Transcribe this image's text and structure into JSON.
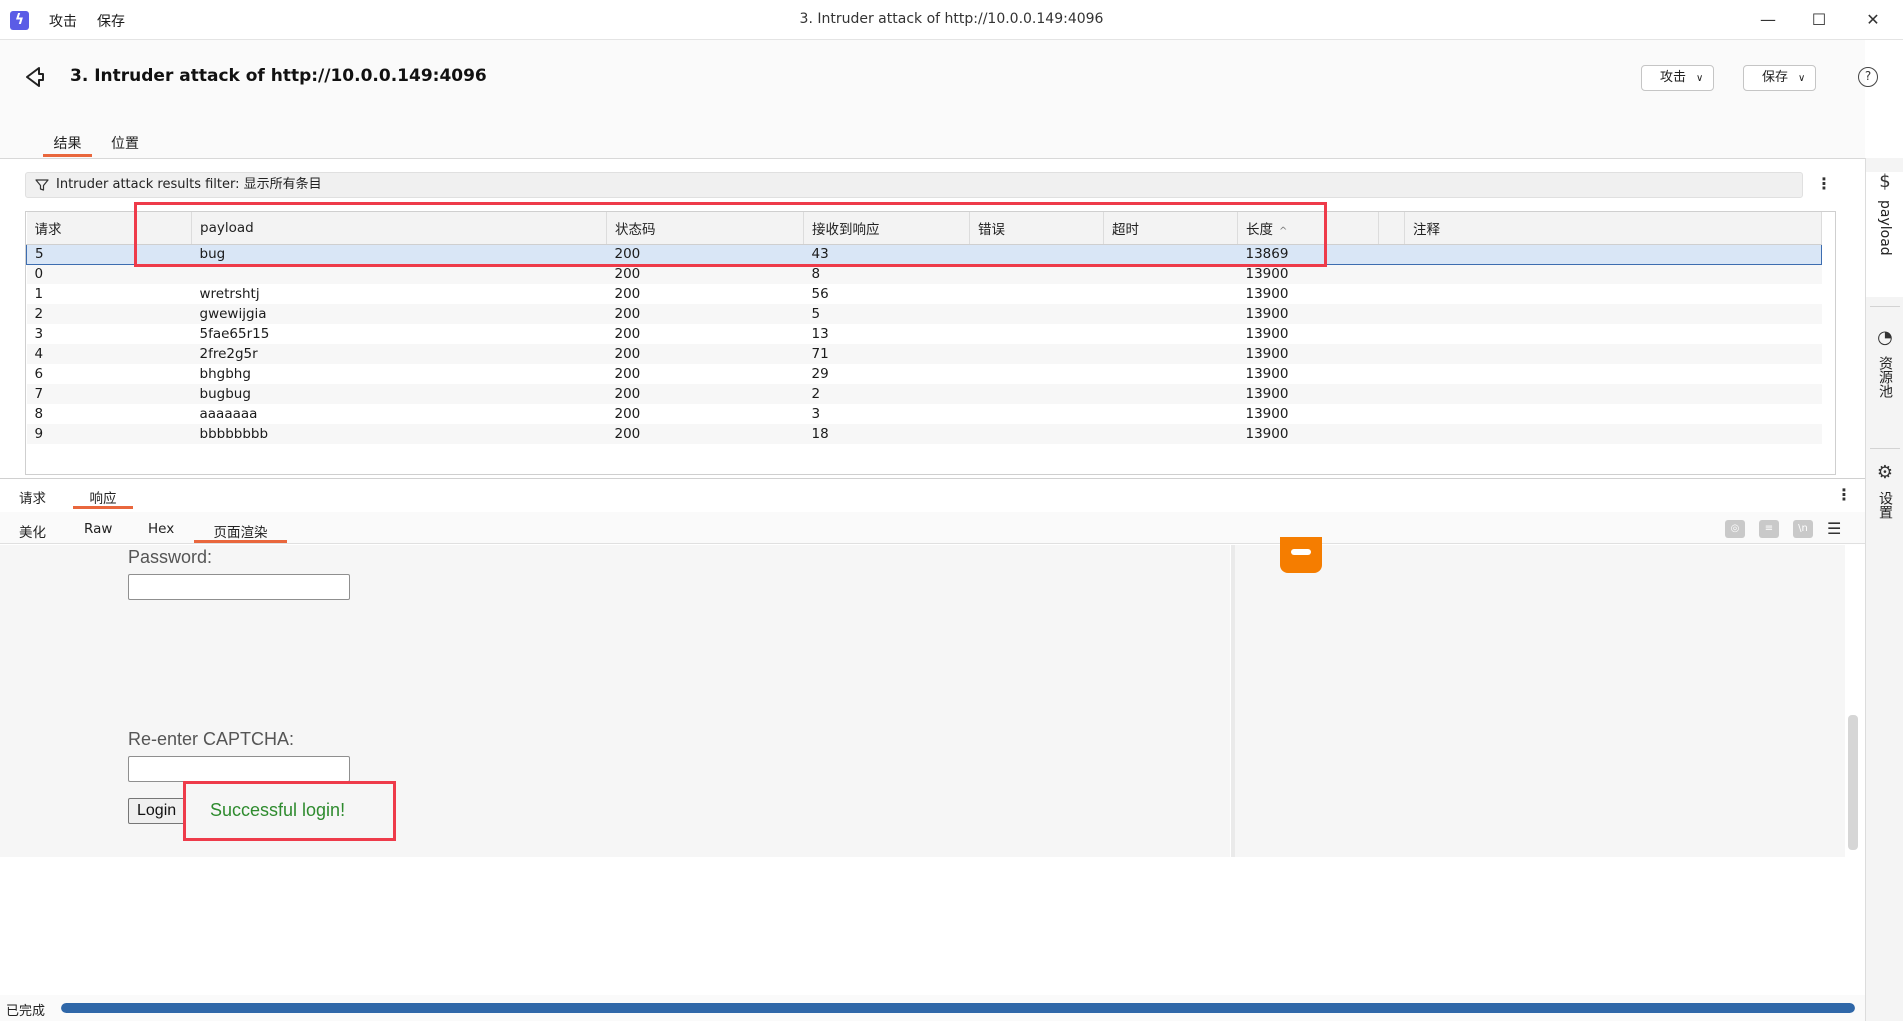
{
  "titlebar": {
    "menu": [
      "攻击",
      "保存"
    ],
    "window_title": "3. Intruder attack of http://10.0.0.149:4096",
    "controls": {
      "minimize": "—",
      "maximize": "☐",
      "close": "✕"
    }
  },
  "header": {
    "title": "3. Intruder attack of http://10.0.0.149:4096",
    "attack_button": "攻击",
    "save_button": "保存",
    "help": "?"
  },
  "tabs": [
    "结果",
    "位置"
  ],
  "filter": {
    "label": "Intruder attack results filter: 显示所有条目"
  },
  "table": {
    "columns": [
      "请求",
      "",
      "payload",
      "状态码",
      "接收到响应",
      "错误",
      "超时",
      "长度",
      "",
      "注释"
    ],
    "sort_icon": "^",
    "rows": [
      [
        "5",
        "",
        "bug",
        "200",
        "43",
        "",
        "",
        "13869",
        "",
        ""
      ],
      [
        "0",
        "",
        "",
        "200",
        "8",
        "",
        "",
        "13900",
        "",
        ""
      ],
      [
        "1",
        "",
        "wretrshtj",
        "200",
        "56",
        "",
        "",
        "13900",
        "",
        ""
      ],
      [
        "2",
        "",
        "gwewijgia",
        "200",
        "5",
        "",
        "",
        "13900",
        "",
        ""
      ],
      [
        "3",
        "",
        "5fae65r15",
        "200",
        "13",
        "",
        "",
        "13900",
        "",
        ""
      ],
      [
        "4",
        "",
        "2fre2g5r",
        "200",
        "71",
        "",
        "",
        "13900",
        "",
        ""
      ],
      [
        "6",
        "",
        "bhgbhg",
        "200",
        "29",
        "",
        "",
        "13900",
        "",
        ""
      ],
      [
        "7",
        "",
        "bugbug",
        "200",
        "2",
        "",
        "",
        "13900",
        "",
        ""
      ],
      [
        "8",
        "",
        "aaaaaaa",
        "200",
        "3",
        "",
        "",
        "13900",
        "",
        ""
      ],
      [
        "9",
        "",
        "bbbbbbbb",
        "200",
        "18",
        "",
        "",
        "13900",
        "",
        ""
      ]
    ],
    "selected_row": 0
  },
  "bottom_tabs": [
    "请求",
    "响应"
  ],
  "view_tabs": [
    "美化",
    "Raw",
    "Hex",
    "页面渲染"
  ],
  "render": {
    "password_label": "Password:",
    "captcha_label": "Re-enter CAPTCHA:",
    "login_button": "Login",
    "success_message": "Successful login!"
  },
  "status": {
    "text": "已完成",
    "progress": 1.0
  },
  "rail": {
    "payload": "payload",
    "resource_pool": "资源池",
    "settings": "设置"
  },
  "colors": {
    "accent": "#e9673d",
    "highlight_box": "#ee3b4a",
    "selection": "#d9e6f6",
    "progress": "#2f67a8",
    "success": "#2e8b2e"
  }
}
